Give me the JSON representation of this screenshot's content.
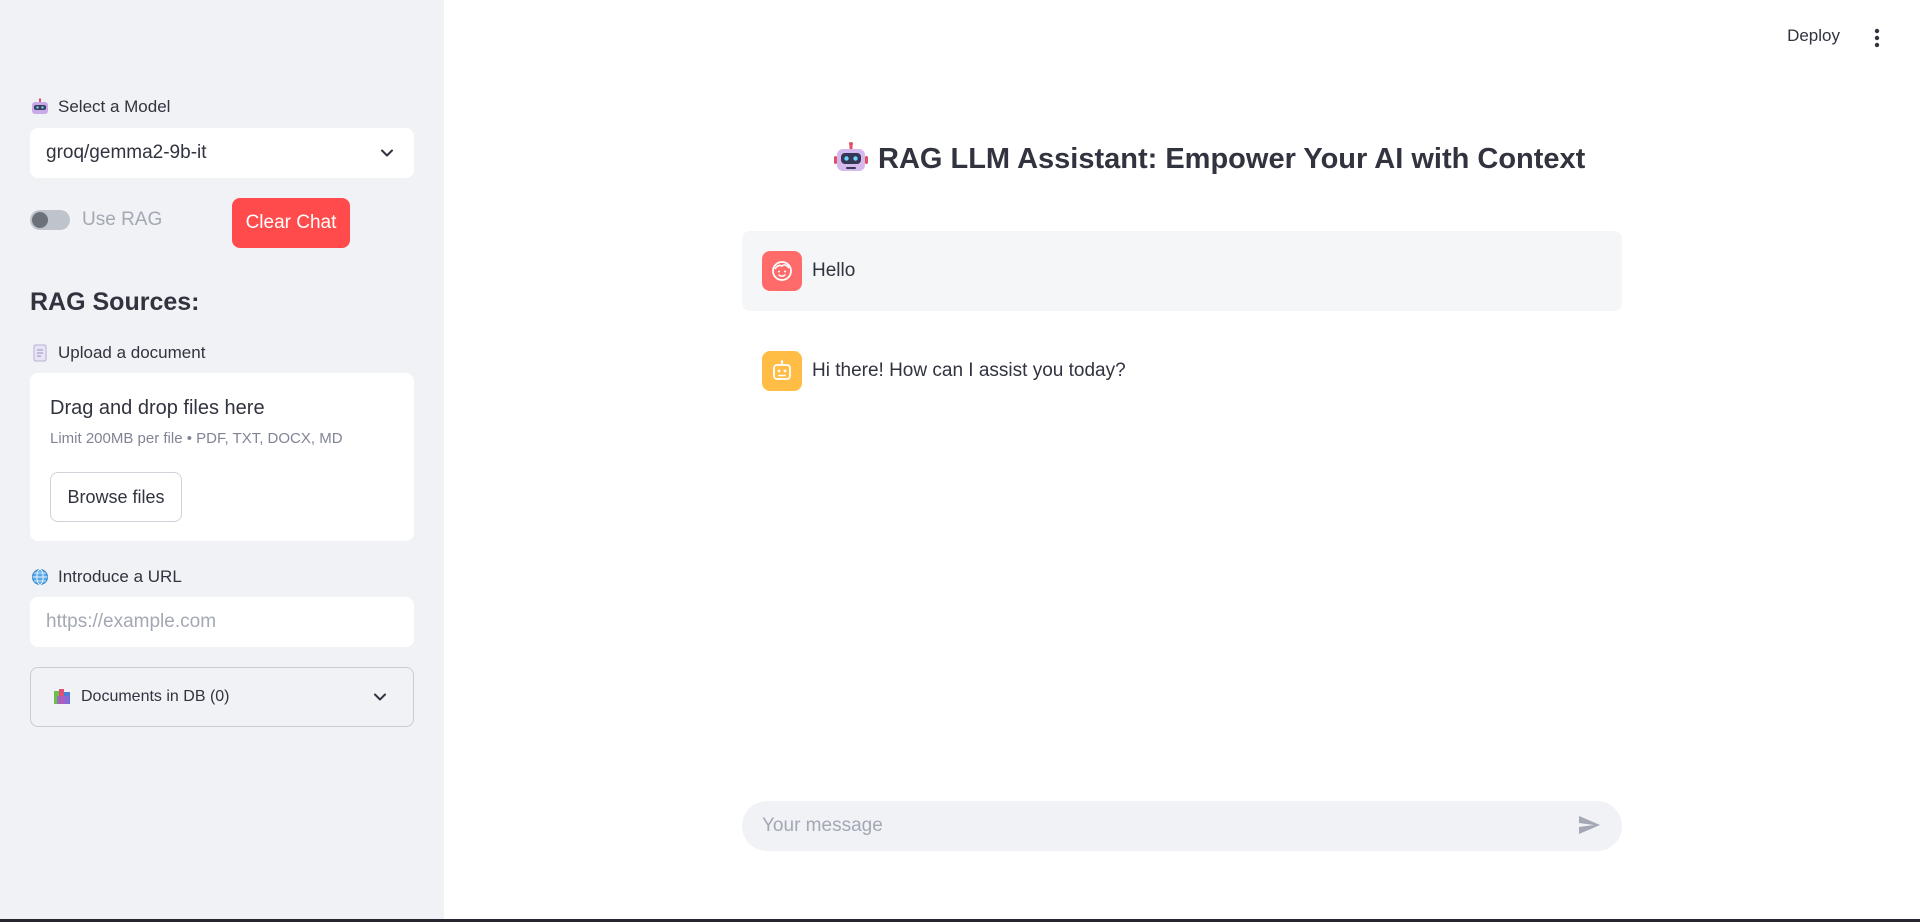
{
  "sidebar": {
    "model_label": "Select a Model",
    "model_label_icon": "robot-icon",
    "model_selected": "groq/gemma2-9b-it",
    "use_rag_label": "Use RAG",
    "use_rag_enabled": false,
    "clear_chat_label": "Clear Chat",
    "rag_heading": "RAG Sources:",
    "upload_label": "Upload a document",
    "upload_label_icon": "document-icon",
    "upload_title": "Drag and drop files here",
    "upload_limits": "Limit 200MB per file • PDF, TXT, DOCX, MD",
    "browse_label": "Browse files",
    "url_label": "Introduce a URL",
    "url_label_icon": "globe-icon",
    "url_placeholder": "https://example.com",
    "documents_label": "Documents in DB (0)",
    "documents_icon": "books-icon"
  },
  "header": {
    "deploy_label": "Deploy"
  },
  "main": {
    "title": "RAG LLM Assistant: Empower Your AI with Context",
    "messages": [
      {
        "role": "user",
        "text": "Hello"
      },
      {
        "role": "assistant",
        "text": "Hi there! How can I assist you today?"
      }
    ],
    "chat_placeholder": "Your message"
  },
  "colors": {
    "accent": "#ff4b4b",
    "sidebar_bg": "#f0f2f6",
    "user_avatar": "#ff6b6b",
    "assistant_avatar": "#ffbd45"
  }
}
